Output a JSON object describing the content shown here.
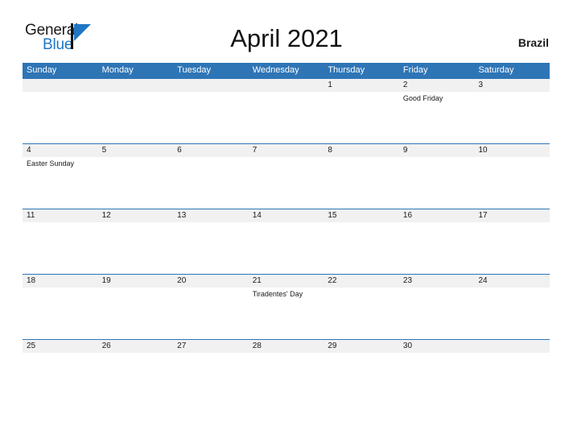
{
  "brand": {
    "name_part1": "General",
    "name_part2": "Blue",
    "flag_icon": "blue-triangle-flag-icon",
    "flag_color": "#1f76c4",
    "pole_color": "#111111"
  },
  "header": {
    "title": "April 2021",
    "country": "Brazil"
  },
  "theme": {
    "header_blue": "#2e75b6",
    "row_divider_blue": "#2e75b6",
    "date_band_gray": "#f1f1f1",
    "body_white": "#ffffff",
    "text_dark": "#1a1a1a",
    "text_on_blue": "#ffffff"
  },
  "calendar": {
    "month": "April",
    "year": "2021",
    "weekday_headers": [
      "Sunday",
      "Monday",
      "Tuesday",
      "Wednesday",
      "Thursday",
      "Friday",
      "Saturday"
    ],
    "weeks": [
      {
        "days": [
          {
            "date": "",
            "event": ""
          },
          {
            "date": "",
            "event": ""
          },
          {
            "date": "",
            "event": ""
          },
          {
            "date": "",
            "event": ""
          },
          {
            "date": "1",
            "event": ""
          },
          {
            "date": "2",
            "event": "Good Friday"
          },
          {
            "date": "3",
            "event": ""
          }
        ]
      },
      {
        "days": [
          {
            "date": "4",
            "event": "Easter Sunday"
          },
          {
            "date": "5",
            "event": ""
          },
          {
            "date": "6",
            "event": ""
          },
          {
            "date": "7",
            "event": ""
          },
          {
            "date": "8",
            "event": ""
          },
          {
            "date": "9",
            "event": ""
          },
          {
            "date": "10",
            "event": ""
          }
        ]
      },
      {
        "days": [
          {
            "date": "11",
            "event": ""
          },
          {
            "date": "12",
            "event": ""
          },
          {
            "date": "13",
            "event": ""
          },
          {
            "date": "14",
            "event": ""
          },
          {
            "date": "15",
            "event": ""
          },
          {
            "date": "16",
            "event": ""
          },
          {
            "date": "17",
            "event": ""
          }
        ]
      },
      {
        "days": [
          {
            "date": "18",
            "event": ""
          },
          {
            "date": "19",
            "event": ""
          },
          {
            "date": "20",
            "event": ""
          },
          {
            "date": "21",
            "event": "Tiradentes' Day"
          },
          {
            "date": "22",
            "event": ""
          },
          {
            "date": "23",
            "event": ""
          },
          {
            "date": "24",
            "event": ""
          }
        ]
      },
      {
        "days": [
          {
            "date": "25",
            "event": ""
          },
          {
            "date": "26",
            "event": ""
          },
          {
            "date": "27",
            "event": ""
          },
          {
            "date": "28",
            "event": ""
          },
          {
            "date": "29",
            "event": ""
          },
          {
            "date": "30",
            "event": ""
          },
          {
            "date": "",
            "event": ""
          }
        ]
      }
    ]
  }
}
